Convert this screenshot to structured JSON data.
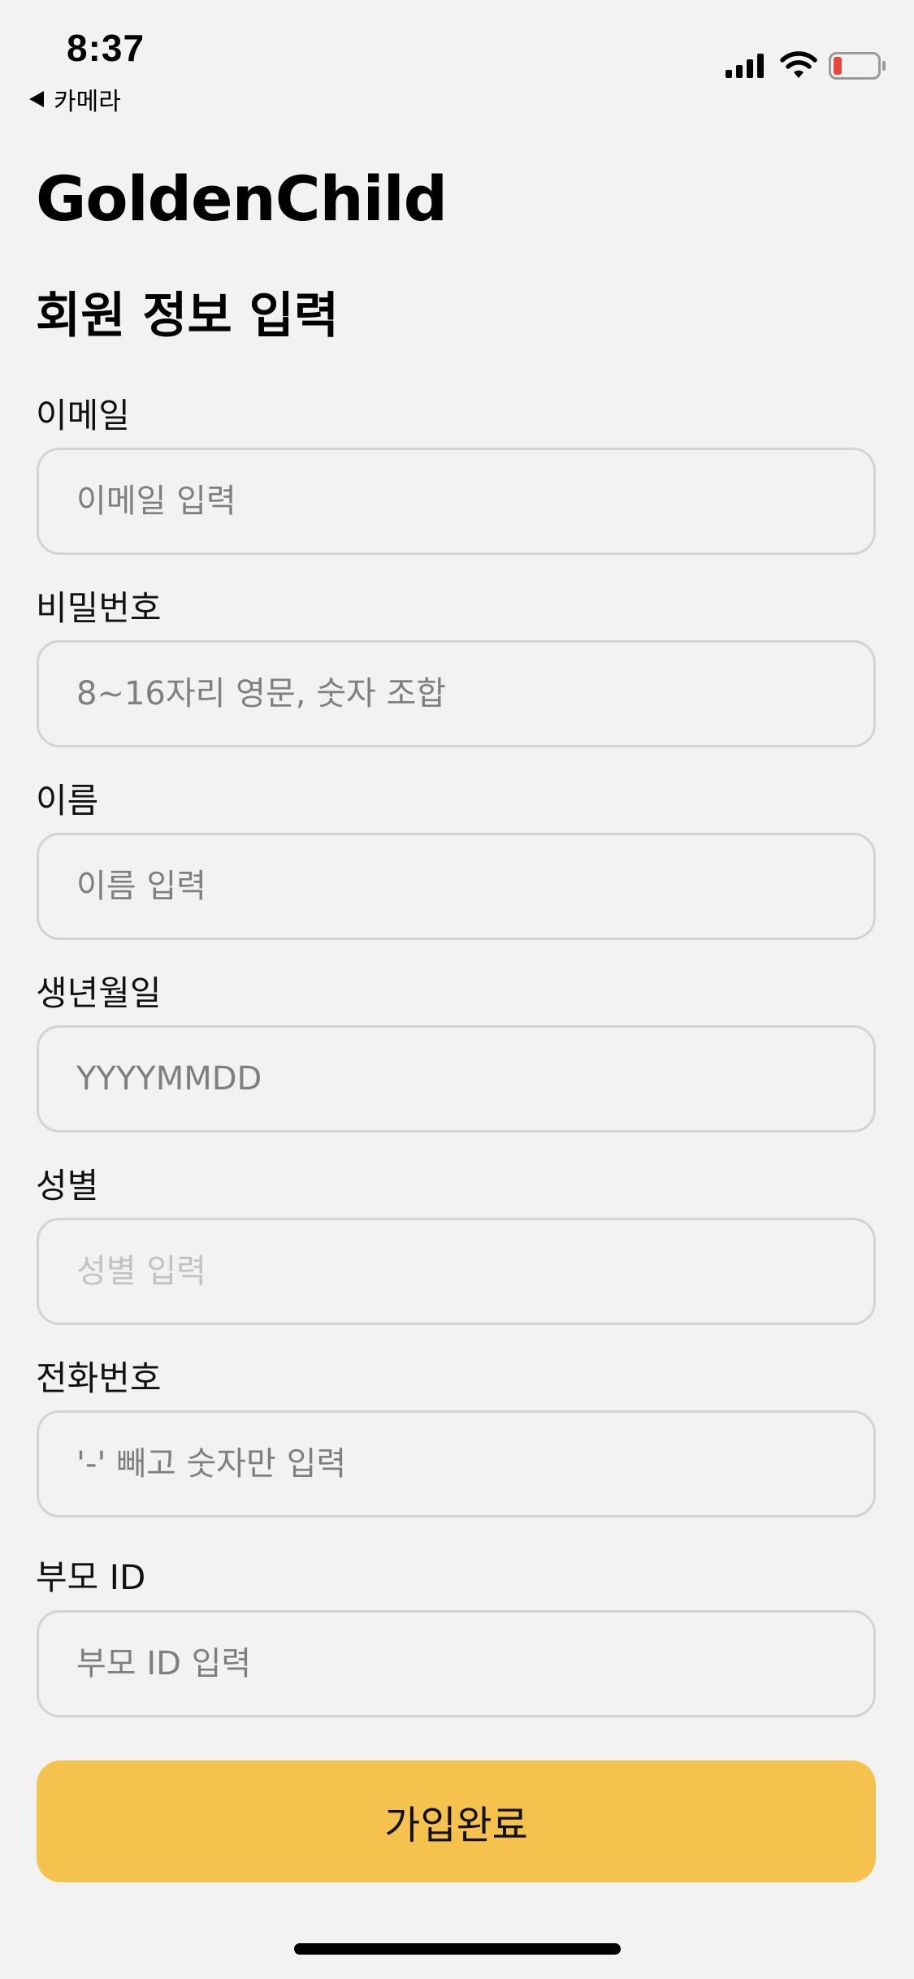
{
  "status_bar": {
    "time": "8:37",
    "back_app_label": "카메라",
    "icons": [
      "signal-icon",
      "wifi-icon",
      "battery-icon"
    ],
    "battery_color": "#e5483d"
  },
  "brand": "GoldenChild",
  "title": "회원 정보 입력",
  "form": {
    "fields": [
      {
        "label": "이메일",
        "placeholder": "이메일 입력",
        "value": ""
      },
      {
        "label": "비밀번호",
        "placeholder": "8~16자리 영문, 숫자 조합",
        "value": ""
      },
      {
        "label": "이름",
        "placeholder": "이름 입력",
        "value": ""
      },
      {
        "label": "생년월일",
        "placeholder": "YYYYMMDD",
        "value": ""
      },
      {
        "label": "성별",
        "placeholder": "성별 입력",
        "value": ""
      },
      {
        "label": "전화번호",
        "placeholder": "'-' 빼고 숫자만 입력",
        "value": ""
      },
      {
        "label": "부모 ID",
        "placeholder": "부모 ID 입력",
        "value": ""
      }
    ],
    "submit_label": "가입완료",
    "submit_color": "#f6c24e"
  }
}
